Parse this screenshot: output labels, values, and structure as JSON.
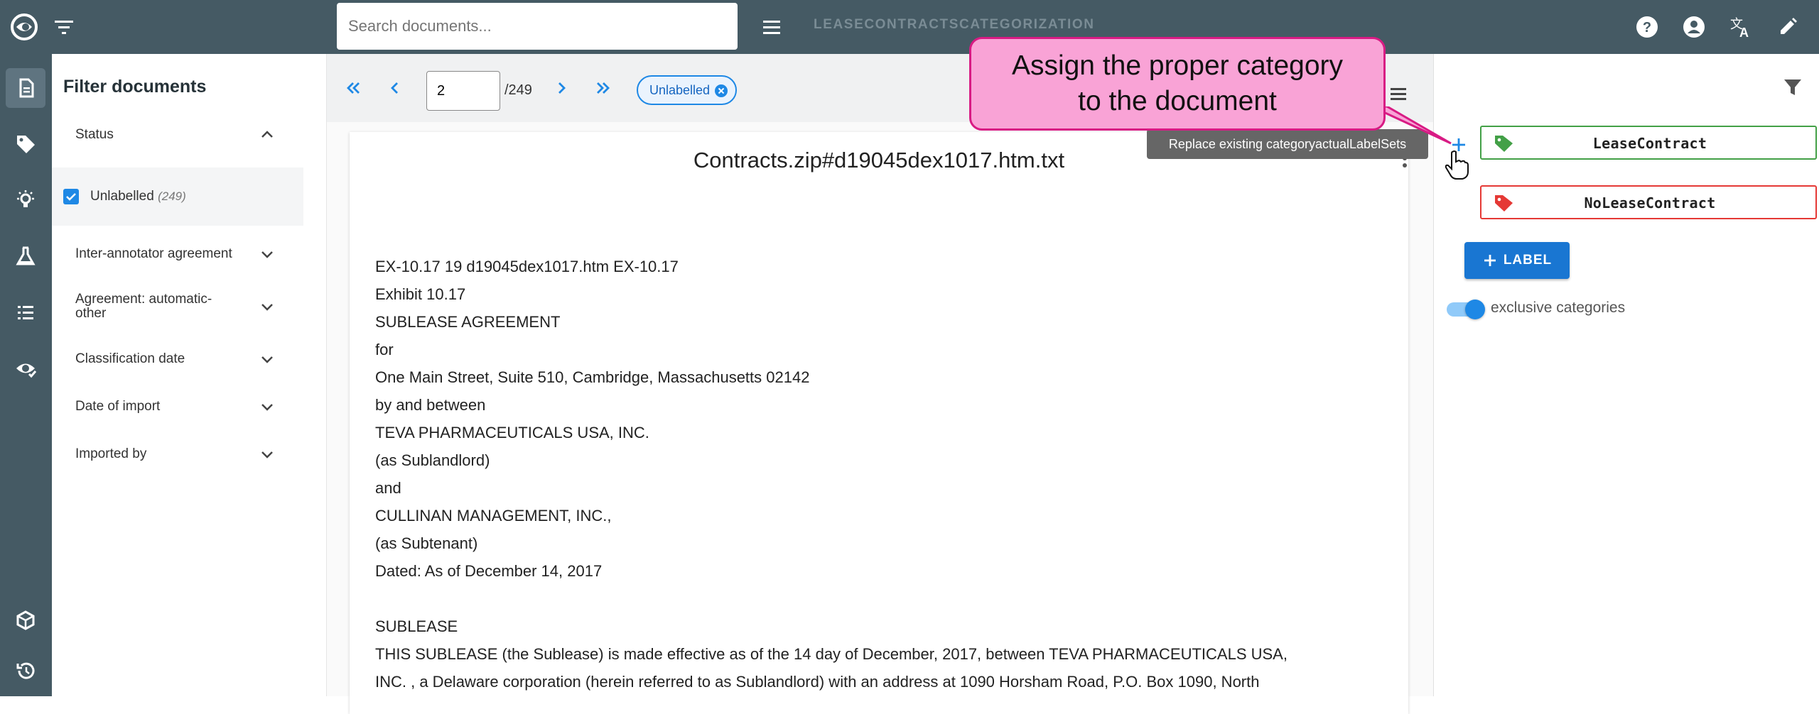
{
  "topbar": {
    "search_placeholder": "Search documents...",
    "project_name": "LEASECONTRACTSCATEGORIZATION"
  },
  "filter_panel": {
    "title": "Filter documents",
    "status_label": "Status",
    "unlabelled_label": "Unlabelled",
    "unlabelled_count": "(249)",
    "filters": [
      "Inter-annotator agreement",
      "Agreement: automatic-other",
      "Classification date",
      "Date of import",
      "Imported by"
    ]
  },
  "pager": {
    "page_value": "2",
    "page_total": "/249",
    "chip_label": "Unlabelled"
  },
  "document": {
    "title": "Contracts.zip#d19045dex1017.htm.txt",
    "lines": [
      "EX-10.17 19 d19045dex1017.htm EX-10.17",
      "Exhibit 10.17",
      "SUBLEASE AGREEMENT",
      "for",
      "One Main Street, Suite 510, Cambridge, Massachusetts 02142",
      "by and between",
      "TEVA PHARMACEUTICALS USA, INC.",
      "(as Sublandlord)",
      "and",
      "CULLINAN MANAGEMENT, INC.,",
      "(as Subtenant)",
      "Dated: As of December 14, 2017",
      "",
      "SUBLEASE",
      "THIS SUBLEASE (the Sublease) is made effective as of the 14 day of December, 2017, between TEVA PHARMACEUTICALS USA,",
      "INC. , a Delaware corporation (herein referred to as Sublandlord) with an address at 1090 Horsham Road, P.O. Box 1090, North"
    ]
  },
  "right_panel": {
    "categories": [
      {
        "name": "LeaseContract",
        "color": "#43a047"
      },
      {
        "name": "NoLeaseContract",
        "color": "#e53935"
      }
    ],
    "label_button": "LABEL",
    "toggle_label": "exclusive categories",
    "toggle_on": true
  },
  "overlay": {
    "tooltip": "Replace existing categoryactualLabelSets",
    "callout_line1": "Assign the proper category",
    "callout_line2": "to the document"
  },
  "colors": {
    "topbar": "#455a64",
    "accent": "#1e88e5",
    "callout": "#f9a3d6"
  }
}
